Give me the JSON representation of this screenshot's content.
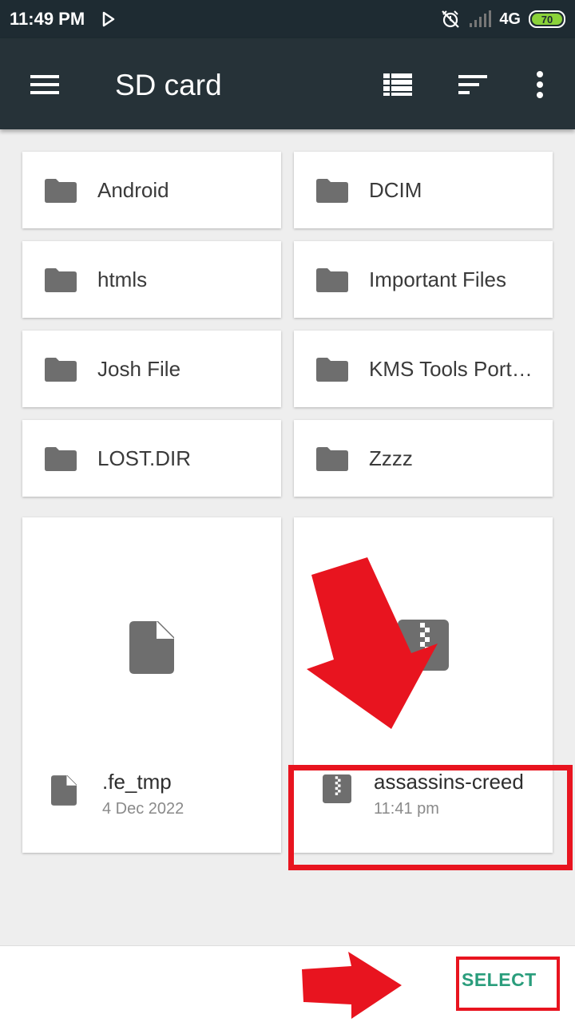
{
  "status_bar": {
    "time": "11:49 PM",
    "network": "4G",
    "battery": "70",
    "icons": [
      "play-store-icon",
      "alarm-off-icon",
      "signal-icon",
      "battery-icon"
    ]
  },
  "app_bar": {
    "title": "SD card",
    "icons": [
      "menu-icon",
      "list-view-icon",
      "sort-icon",
      "more-vert-icon"
    ]
  },
  "folders": [
    {
      "name": "Android"
    },
    {
      "name": "DCIM"
    },
    {
      "name": "htmls"
    },
    {
      "name": "Important Files"
    },
    {
      "name": "Josh File"
    },
    {
      "name": "KMS Tools Portable"
    },
    {
      "name": "LOST.DIR"
    },
    {
      "name": "Zzzz"
    }
  ],
  "files": [
    {
      "name": ".fe_tmp",
      "date": "4 Dec 2022",
      "icon": "file-icon"
    },
    {
      "name": "assassins-creed",
      "date": "11:41 pm",
      "icon": "zip-file-icon"
    }
  ],
  "bottom_bar": {
    "select_label": "SELECT"
  },
  "colors": {
    "status_bar": "#1e2b32",
    "app_bar": "#263238",
    "accent": "#2a9d7c",
    "annotation": "#e8141f",
    "battery": "#8bd23a"
  }
}
